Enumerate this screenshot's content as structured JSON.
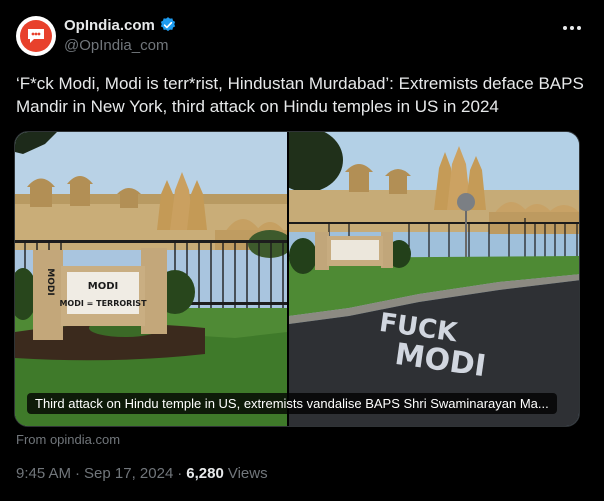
{
  "colors": {
    "background": "#000000",
    "text_primary": "#e7e9ea",
    "text_secondary": "#71767b",
    "verified_blue": "#1d9bf0",
    "brand_red": "#e8412c"
  },
  "author": {
    "display_name": "OpIndia.com",
    "handle": "@OpIndia_com",
    "avatar_icon": "opindia-logo-icon",
    "verified_icon": "verified-badge-icon"
  },
  "tweet": {
    "text": "‘F*ck Modi, Modi is terr*rist, Hindustan Murdabad’: Extremists deface BAPS Mandir in New York, third attack on Hindu temples in US in 2024"
  },
  "link_card": {
    "caption": "Third attack on Hindu temple in US, extremists vandalise BAPS Shri Swaminarayan Ma...",
    "source": "From opindia.com",
    "left_sign_text": [
      "MODI",
      "MODI = TERRORIST"
    ],
    "left_post_text": "MODI",
    "right_road_text": [
      "FUCK",
      "MODI"
    ]
  },
  "meta": {
    "time": "9:45 AM",
    "separator": "·",
    "date": "Sep 17, 2024",
    "views_count": "6,280",
    "views_label": "Views"
  }
}
